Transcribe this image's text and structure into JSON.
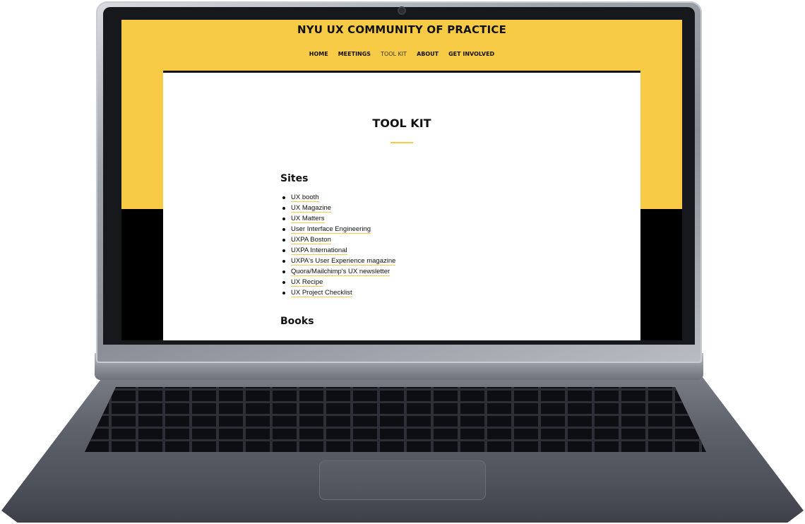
{
  "site": {
    "title": "NYU UX COMMUNITY OF PRACTICE",
    "nav": [
      "HOME",
      "MEETINGS",
      "TOOL KIT",
      "ABOUT",
      "GET INVOLVED"
    ],
    "current_nav": "TOOL KIT"
  },
  "page": {
    "title": "TOOL KIT",
    "sections": [
      {
        "heading": "Sites",
        "links": [
          "UX booth",
          "UX Magazine",
          "UX Matters",
          "User Interface Engineering",
          "UXPA Boston",
          "UXPA International",
          "UXPA's User Experience magazine",
          "Quora/Mailchimp's UX newsletter",
          "UX Recipe",
          "UX Project Checklist"
        ]
      },
      {
        "heading": "Books",
        "links": []
      }
    ]
  },
  "colors": {
    "accent_yellow": "#f8cb46",
    "text": "#111111",
    "background_dark": "#000000"
  }
}
